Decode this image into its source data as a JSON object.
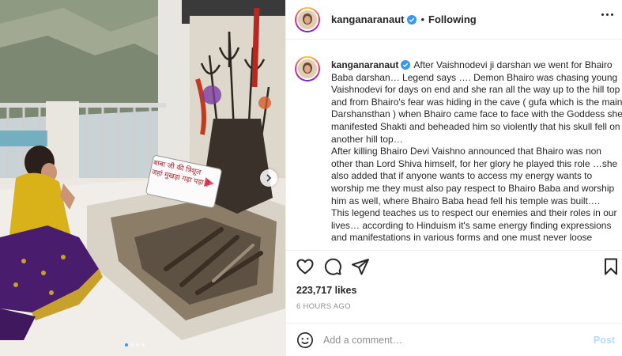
{
  "post": {
    "username": "kanganaranaut",
    "separator": "•",
    "follow_status": "Following",
    "caption_text": "After Vaishnodevi ji darshan we went for Bhairo Baba darshan… Legend says …. Demon Bhairo was chasing young Vaishnodevi for days on end and she ran all the way up to the hill top and from Bhairo's fear was hiding in the cave ( gufa which is the main Darshansthan ) when Bhairo came face to face with the Goddess she manifested Shakti and beheaded him so violently that his skull fell on another hill top…",
    "caption_text_2": "After killing Bhairo Devi Vaishno announced that Bhairo was non other than Lord Shiva himself, for her glory he played this role …she also added that if anyone wants to access my energy wants to worship me they must also pay respect to Bhairo Baba and worship him as well, where Bhairo Baba head fell his temple was built….",
    "caption_text_3": "This legend teaches us to respect our enemies and their roles in our lives… according to Hinduism it's same energy finding expressions and manifestations in various forms and one must never loose",
    "likes": "223,717 likes",
    "time_ago": "6 HOURS AGO",
    "comment_placeholder": "Add a comment…",
    "post_label": "Post"
  },
  "photo": {
    "sign_line_1": "बाबा जी की त्रिशूल",
    "sign_line_2": "जहां मुखड़ा गढ़ा पड़ा है",
    "carousel_count": 4,
    "carousel_active": 0
  },
  "colors": {
    "accent": "#3897f0",
    "verified": "#3897f0",
    "post_disabled": "#b3dbff",
    "muted": "#8e8e8e"
  },
  "icons": {
    "like": "heart-icon",
    "comment": "comment-icon",
    "share": "paper-plane-icon",
    "save": "bookmark-icon",
    "emoji": "smiley-icon",
    "more": "more-options-icon",
    "next": "chevron-right-icon"
  }
}
